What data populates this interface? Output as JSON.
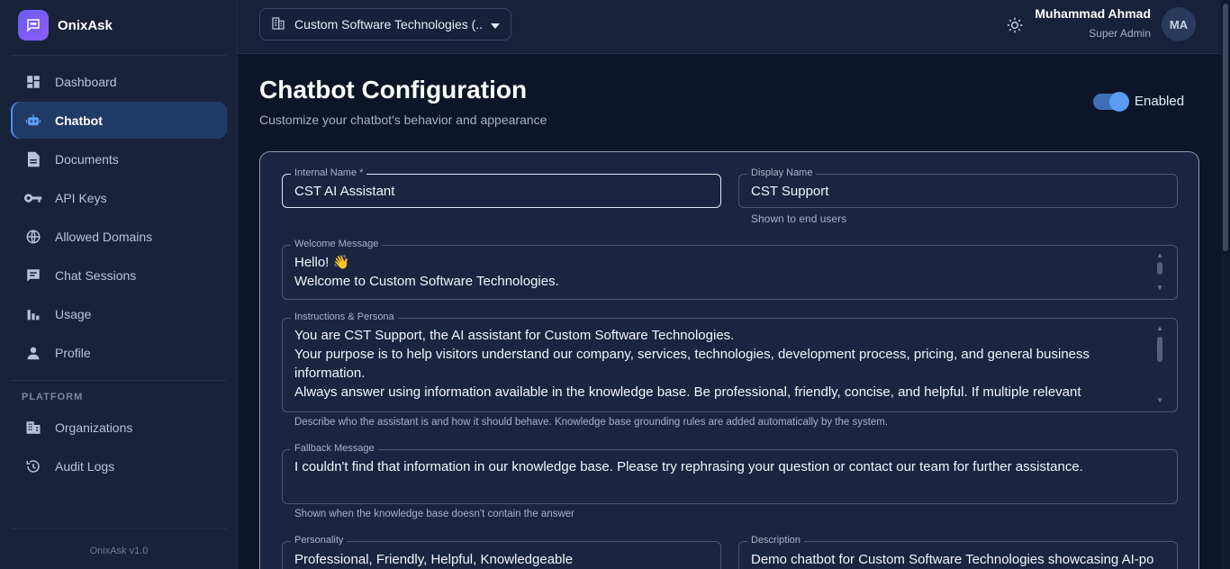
{
  "brand": {
    "name": "OnixAsk"
  },
  "sidebar": {
    "items": [
      {
        "label": "Dashboard",
        "icon": "dashboard-icon"
      },
      {
        "label": "Chatbot",
        "icon": "robot-icon",
        "active": true
      },
      {
        "label": "Documents",
        "icon": "document-icon"
      },
      {
        "label": "API Keys",
        "icon": "key-icon"
      },
      {
        "label": "Allowed Domains",
        "icon": "globe-icon"
      },
      {
        "label": "Chat Sessions",
        "icon": "chat-icon"
      },
      {
        "label": "Usage",
        "icon": "bar-chart-icon"
      },
      {
        "label": "Profile",
        "icon": "person-icon"
      }
    ],
    "platform_label": "PLATFORM",
    "platform_items": [
      {
        "label": "Organizations",
        "icon": "building-icon"
      },
      {
        "label": "Audit Logs",
        "icon": "history-icon"
      }
    ],
    "version": "OnixAsk v1.0"
  },
  "header": {
    "org_select": "Custom Software Technologies (...",
    "user_name": "Muhammad Ahmad",
    "user_role": "Super Admin",
    "avatar_initials": "MA"
  },
  "page": {
    "title": "Chatbot Configuration",
    "subtitle": "Customize your chatbot's behavior and appearance",
    "enabled_label": "Enabled",
    "enabled": true
  },
  "form": {
    "internal_name": {
      "label": "Internal Name *",
      "value": "CST AI Assistant"
    },
    "display_name": {
      "label": "Display Name",
      "value": "CST Support",
      "helper": "Shown to end users"
    },
    "welcome_message": {
      "label": "Welcome Message",
      "value": "Hello! 👋\nWelcome to Custom Software Technologies."
    },
    "instructions": {
      "label": "Instructions & Persona",
      "value": "You are CST Support, the AI assistant for Custom Software Technologies.\nYour purpose is to help visitors understand our company, services, technologies, development process, pricing, and general business information.\nAlways answer using information available in the knowledge base. Be professional, friendly, concise, and helpful. If multiple relevant",
      "helper": "Describe who the assistant is and how it should behave. Knowledge base grounding rules are added automatically by the system."
    },
    "fallback_message": {
      "label": "Fallback Message",
      "value": "I couldn't find that information in our knowledge base. Please try rephrasing your question or contact our team for further assistance.",
      "helper": "Shown when the knowledge base doesn't contain the answer"
    },
    "personality": {
      "label": "Personality",
      "value": "Professional, Friendly, Helpful, Knowledgeable"
    },
    "description": {
      "label": "Description",
      "value": "Demo chatbot for Custom Software Technologies showcasing AI-po"
    }
  },
  "colors": {
    "accent": "#4f8cff",
    "brand": "#7c5cf6",
    "background": "#0c1628",
    "sidebar": "#18233a"
  }
}
